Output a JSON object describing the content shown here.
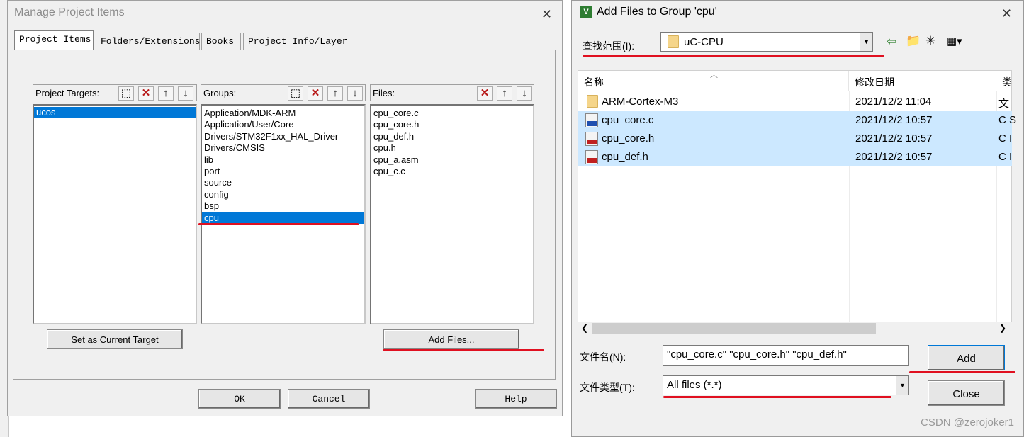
{
  "manage_dialog": {
    "title": "Manage Project Items",
    "tabs": [
      "Project Items",
      "Folders/Extensions",
      "Books",
      "Project Info/Layer"
    ],
    "targets_label": "Project Targets:",
    "targets": [
      "ucos"
    ],
    "groups_label": "Groups:",
    "groups": [
      "Application/MDK-ARM",
      "Application/User/Core",
      "Drivers/STM32F1xx_HAL_Driver",
      "Drivers/CMSIS",
      "lib",
      "port",
      "source",
      "config",
      "bsp",
      "cpu"
    ],
    "selected_group": "cpu",
    "files_label": "Files:",
    "files": [
      "cpu_core.c",
      "cpu_core.h",
      "cpu_def.h",
      "cpu.h",
      "cpu_a.asm",
      "cpu_c.c"
    ],
    "set_target_label": "Set as Current Target",
    "add_files_label": "Add Files...",
    "ok_label": "OK",
    "cancel_label": "Cancel",
    "help_label": "Help"
  },
  "add_dialog": {
    "title": "Add Files to Group 'cpu'",
    "app_icon_text": "V",
    "look_in_label": "查找范围(I):",
    "look_in_value": "uC-CPU",
    "col_name": "名称",
    "col_date": "修改日期",
    "col_type": "类",
    "rows": [
      {
        "name": "ARM-Cortex-M3",
        "date": "2021/12/2 11:04",
        "type": "文",
        "icon": "folder-icon",
        "selected": false
      },
      {
        "name": "cpu_core.c",
        "date": "2021/12/2 10:57",
        "type": "C S",
        "icon": "c-file-icon",
        "selected": true
      },
      {
        "name": "cpu_core.h",
        "date": "2021/12/2 10:57",
        "type": "C I",
        "icon": "h-file-icon",
        "selected": true
      },
      {
        "name": "cpu_def.h",
        "date": "2021/12/2 10:57",
        "type": "C I",
        "icon": "h-file-icon",
        "selected": true
      }
    ],
    "filename_label": "文件名(N):",
    "filename_value": "\"cpu_core.c\" \"cpu_core.h\" \"cpu_def.h\"",
    "filetype_label": "文件类型(T):",
    "filetype_value": "All files (*.*)",
    "add_label": "Add",
    "close_label": "Close"
  },
  "watermark": "CSDN @zerojoker1",
  "colors": {
    "selection": "#0078d7",
    "file_selection": "#cce8ff",
    "annotation_red": "#e01020"
  }
}
